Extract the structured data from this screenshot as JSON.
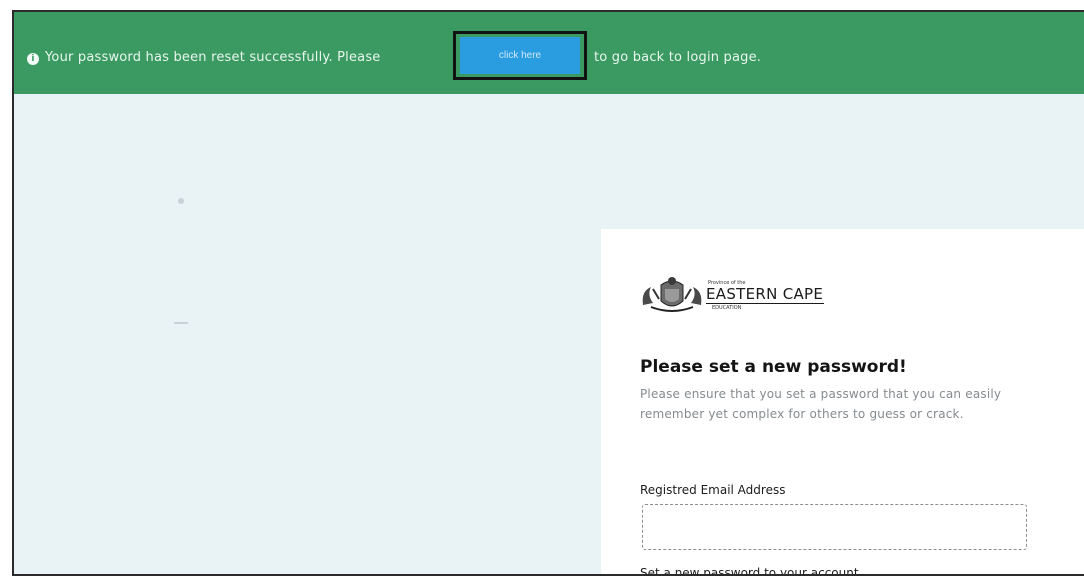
{
  "banner": {
    "icon": "info-icon",
    "message_start": "Your password has been reset successfully. Please",
    "button_label": "click here",
    "message_end": "to go back to login page.",
    "background_color": "#3a9a62",
    "button_color": "#2a9de0"
  },
  "logo": {
    "province_text": "Province of the",
    "name": "EASTERN CAPE",
    "subtitle": "EDUCATION",
    "icon": "coat-of-arms-icon"
  },
  "form": {
    "title": "Please set a new password!",
    "description": "Please ensure that you set a password that you can easily remember yet complex for others to guess or crack.",
    "email_label": "Registred Email Address",
    "email_value": "",
    "password_label": "Set a new password to your account"
  }
}
